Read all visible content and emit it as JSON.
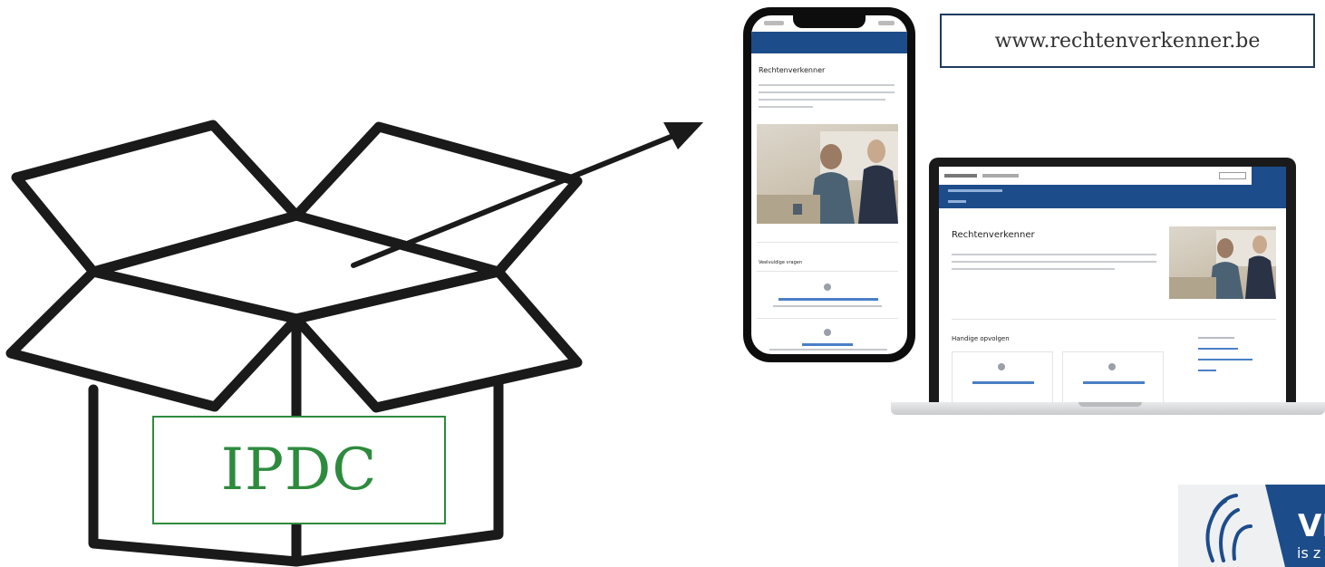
{
  "url_box": {
    "text": "www.rechtenverkenner.be"
  },
  "box_label": {
    "text": "IPDC"
  },
  "phone": {
    "page_title": "Rechtenverkenner",
    "section_title": "Veelvuldige vragen"
  },
  "laptop": {
    "page_title": "Rechtenverkenner",
    "section_title": "Handige opvolgen"
  },
  "logo": {
    "text_main": "VL",
    "text_sub": "is z"
  },
  "colors": {
    "navy": "#1d4c8a",
    "green": "#2e8b3e",
    "box_outline": "#1f3a5f"
  }
}
